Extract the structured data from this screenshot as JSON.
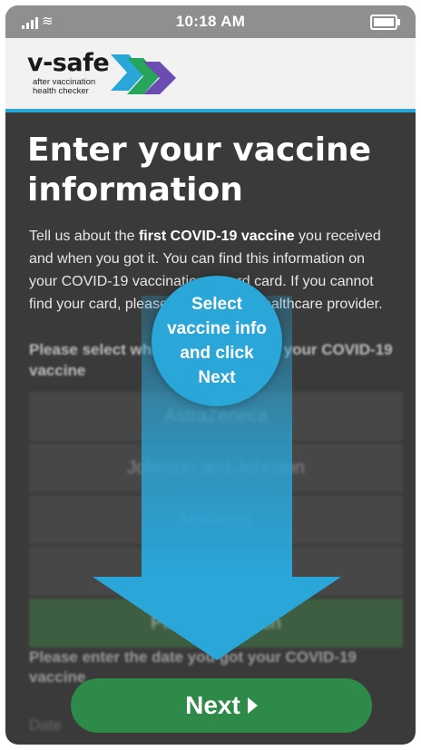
{
  "status_bar": {
    "time": "10:18 AM",
    "signal_icon": "signal-icon",
    "wifi_icon": "wifi-icon",
    "battery_icon": "battery-icon"
  },
  "header": {
    "logo_text": "v-safe",
    "logo_tagline_1": "after vaccination",
    "logo_tagline_2": "health checker"
  },
  "page": {
    "title": "Enter your vaccine information",
    "intro_before": "Tell us about the ",
    "intro_bold": "first COVID-19 vaccine",
    "intro_after": " you received and when you got it. You can find this information on your COVID-19 vaccination record card. If you cannot find your card, please contact your healthcare provider.",
    "question": "Please select which vaccine made your COVID-19 vaccine",
    "options": [
      {
        "label": "AstraZeneca"
      },
      {
        "label": "Johnson and Johnson"
      },
      {
        "label": "Moderna"
      },
      {
        "label": "Novavax"
      },
      {
        "label": "Pfizer-BioNTech"
      }
    ],
    "date_question": "Please enter the date you got your COVID-19 vaccine",
    "date_placeholder": "Date"
  },
  "callout": {
    "line1": "Select",
    "line2": "vaccine info",
    "line3": "and click",
    "line4": "Next"
  },
  "next_button": {
    "label": "Next"
  },
  "colors": {
    "accent_blue": "#2aa6d9",
    "button_green": "#2e8a48",
    "background": "#3a3a3a"
  }
}
